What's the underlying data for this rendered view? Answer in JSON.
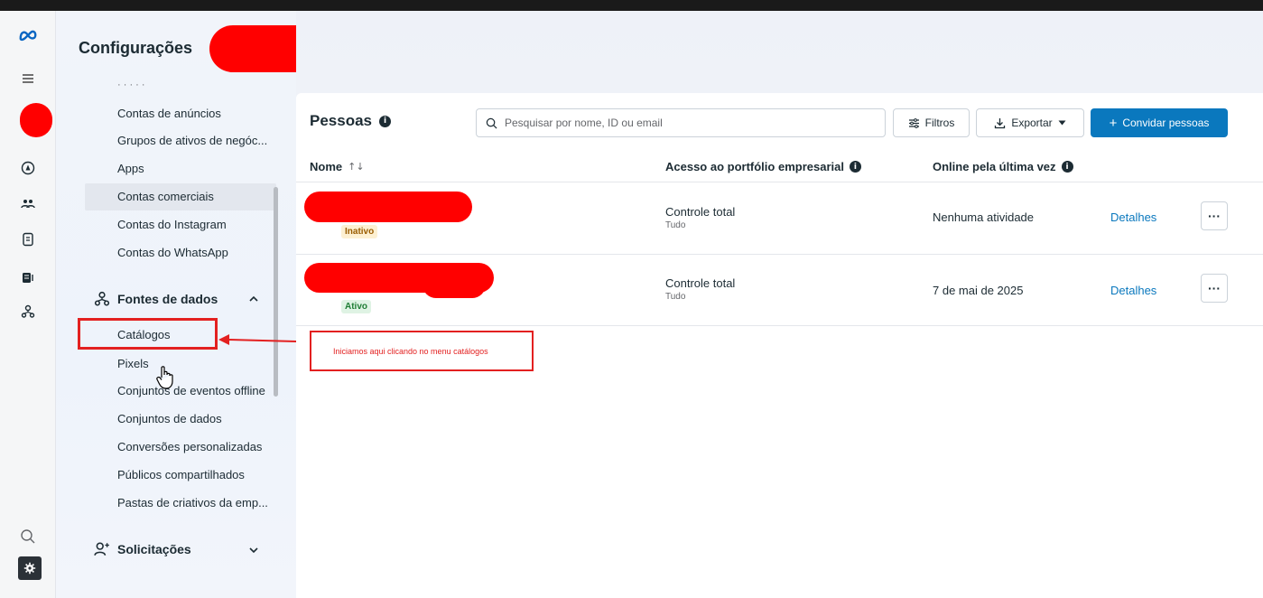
{
  "header": {
    "title": "Configurações"
  },
  "rail": {
    "icons": [
      "meta-logo-icon",
      "menu-icon",
      "compass-icon",
      "people-icon",
      "document-icon",
      "stack-icon",
      "hierarchy-icon",
      "search-icon",
      "settings-icon"
    ]
  },
  "sidebar": {
    "items_top": [
      "Contas de anúncios",
      "Grupos de ativos de negóc...",
      "Apps",
      "Contas comerciais",
      "Contas do Instagram",
      "Contas do WhatsApp"
    ],
    "section_data_sources": "Fontes de dados",
    "items_data_sources": [
      "Catálogos",
      "Pixels",
      "Conjuntos de eventos offline",
      "Conjuntos de dados",
      "Conversões personalizadas",
      "Públicos compartilhados",
      "Pastas de criativos da emp..."
    ],
    "section_requests": "Solicitações"
  },
  "annotation": {
    "text": "Iniciamos aqui clicando no menu catálogos"
  },
  "main": {
    "title": "Pessoas",
    "search_placeholder": "Pesquisar por nome, ID ou email",
    "filters_label": "Filtros",
    "export_label": "Exportar",
    "invite_label": "Convidar pessoas",
    "columns": {
      "name": "Nome",
      "access": "Acesso ao portfólio empresarial",
      "last_online": "Online pela última vez"
    },
    "rows": [
      {
        "status": "Inativo",
        "access": "Controle total",
        "access_sub": "Tudo",
        "last_online": "Nenhuma atividade",
        "details": "Detalhes"
      },
      {
        "status": "Ativo",
        "access": "Controle total",
        "access_sub": "Tudo",
        "last_online": "7 de mai de 2025",
        "details": "Detalhes"
      }
    ]
  },
  "colors": {
    "accent": "#0a78be",
    "annotation_red": "#e32020",
    "redaction": "#ff0000",
    "inactive_badge_bg": "#fdf0d2",
    "inactive_badge_text": "#9a5d00",
    "active_badge_bg": "#dff3e4",
    "active_badge_text": "#1e7d34"
  }
}
